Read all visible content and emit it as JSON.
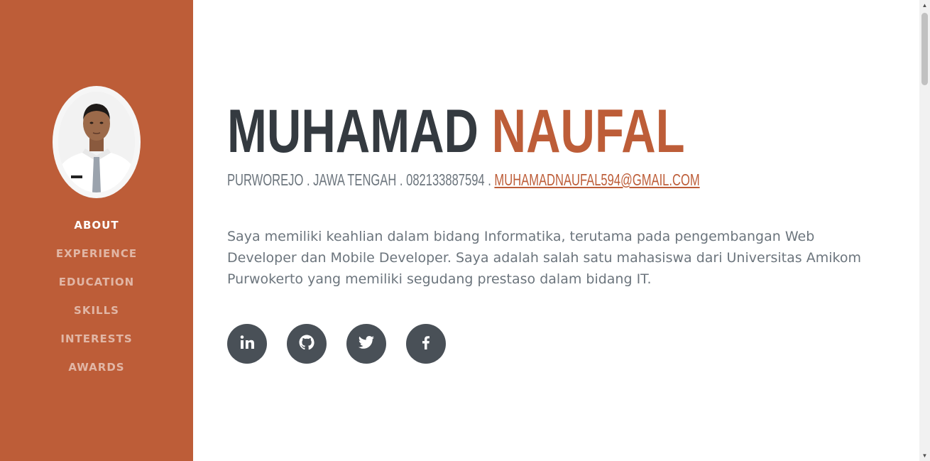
{
  "profile": {
    "first_name": "MUHAMAD",
    "last_name": "NAUFAL",
    "location_phone": "PURWOREJO . JAWA TENGAH . 082133887594 . ",
    "email": "MUHAMADNAUFAL594@GMAIL.COM",
    "about": "Saya memiliki keahlian dalam bidang Informatika, terutama pada pengembangan Web Developer dan Mobile Developer. Saya adalah salah satu mahasiswa dari Universitas Amikom Purwokerto yang memiliki segudang prestaso dalam bidang IT."
  },
  "nav": {
    "items": [
      {
        "label": "ABOUT",
        "active": true
      },
      {
        "label": "EXPERIENCE",
        "active": false
      },
      {
        "label": "EDUCATION",
        "active": false
      },
      {
        "label": "SKILLS",
        "active": false
      },
      {
        "label": "INTERESTS",
        "active": false
      },
      {
        "label": "AWARDS",
        "active": false
      }
    ]
  },
  "social": [
    {
      "icon": "linkedin-icon"
    },
    {
      "icon": "github-icon"
    },
    {
      "icon": "twitter-icon"
    },
    {
      "icon": "facebook-icon"
    }
  ],
  "colors": {
    "primary": "#bd5d38",
    "heading": "#343a40",
    "text": "#6c757d",
    "social_bg": "#495057"
  }
}
